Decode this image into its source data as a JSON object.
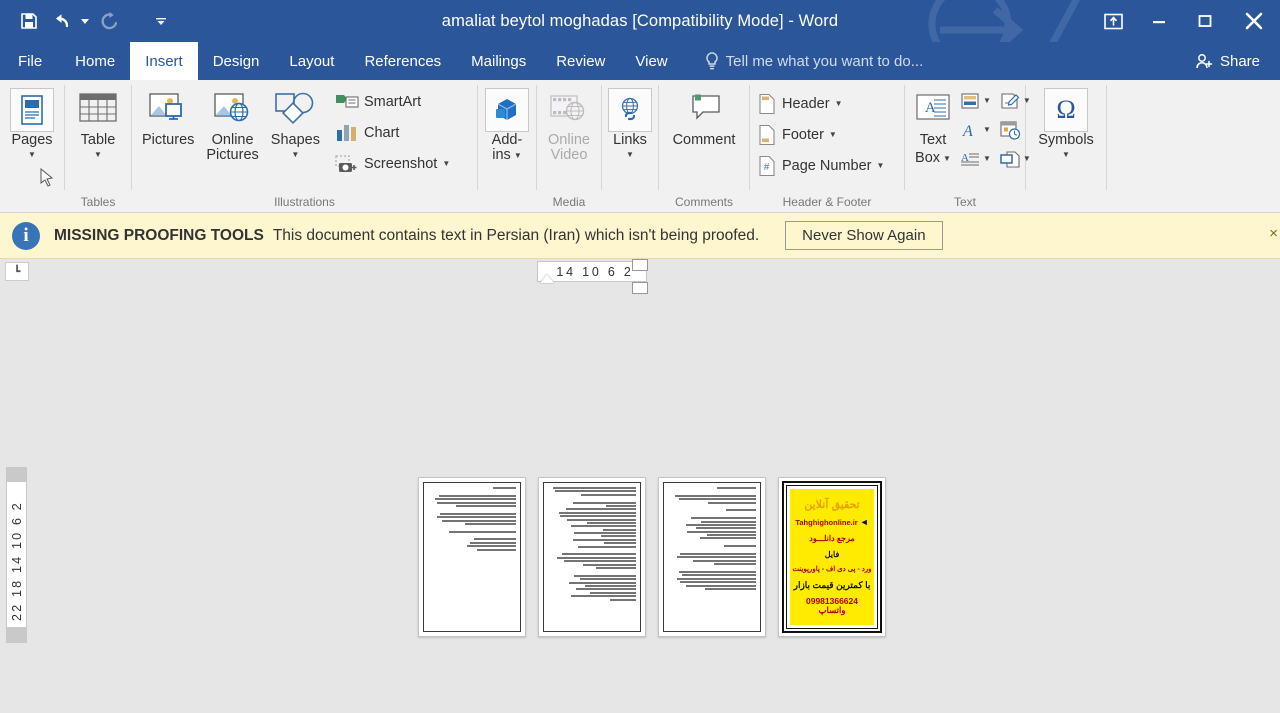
{
  "window": {
    "title": "amaliat beytol moghadas [Compatibility Mode] - Word",
    "quick_access": [
      {
        "name": "save",
        "icon": "save-icon",
        "enabled": true
      },
      {
        "name": "undo",
        "icon": "undo-icon",
        "enabled": true,
        "has_dropdown": true
      },
      {
        "name": "redo",
        "icon": "redo-icon",
        "enabled": false
      },
      {
        "name": "customize",
        "icon": "chevron-down-icon",
        "enabled": true
      }
    ],
    "controls": {
      "ribbon_display": "ribbon-display-options-icon",
      "minimize": "minimize-icon",
      "maximize": "maximize-icon",
      "close": "close-icon"
    },
    "accent_color": "#2b579a"
  },
  "tabs": [
    {
      "label": "File",
      "active": false,
      "is_file": true
    },
    {
      "label": "Home",
      "active": false
    },
    {
      "label": "Insert",
      "active": true
    },
    {
      "label": "Design",
      "active": false
    },
    {
      "label": "Layout",
      "active": false
    },
    {
      "label": "References",
      "active": false
    },
    {
      "label": "Mailings",
      "active": false
    },
    {
      "label": "Review",
      "active": false
    },
    {
      "label": "View",
      "active": false
    }
  ],
  "tellme": {
    "placeholder": "Tell me what you want to do...",
    "icon": "lightbulb-icon"
  },
  "share": {
    "label": "Share",
    "icon": "person-add-icon"
  },
  "ribbon": {
    "groups": [
      {
        "label": "",
        "name": "pages",
        "items": [
          {
            "label": "Pages",
            "icon": "page-break-icon",
            "dropdown": true,
            "style": "big-boxed"
          }
        ]
      },
      {
        "label": "Tables",
        "name": "tables",
        "items": [
          {
            "label": "Table",
            "icon": "table-icon",
            "dropdown": true,
            "style": "big"
          }
        ]
      },
      {
        "label": "Illustrations",
        "name": "illustrations",
        "items": [
          {
            "label": "Pictures",
            "icon": "pictures-icon",
            "style": "big"
          },
          {
            "label": "Online",
            "label2": "Pictures",
            "icon": "online-pictures-icon",
            "style": "big"
          },
          {
            "label": "Shapes",
            "icon": "shapes-icon",
            "dropdown": true,
            "style": "big"
          },
          {
            "label": "SmartArt",
            "icon": "smartart-icon",
            "style": "small"
          },
          {
            "label": "Chart",
            "icon": "chart-icon",
            "style": "small"
          },
          {
            "label": "Screenshot",
            "icon": "screenshot-icon",
            "dropdown": true,
            "style": "small"
          }
        ]
      },
      {
        "label": "",
        "name": "addins",
        "items": [
          {
            "label": "Add-",
            "label2": "ins",
            "icon": "addins-icon",
            "dropdown": true,
            "style": "big-boxed"
          }
        ]
      },
      {
        "label": "Media",
        "name": "media",
        "items": [
          {
            "label": "Online",
            "label2": "Video",
            "icon": "online-video-icon",
            "style": "big",
            "disabled": true
          }
        ]
      },
      {
        "label": "",
        "name": "links",
        "items": [
          {
            "label": "Links",
            "icon": "links-icon",
            "dropdown": true,
            "style": "big-boxed"
          }
        ]
      },
      {
        "label": "Comments",
        "name": "comments",
        "items": [
          {
            "label": "Comment",
            "icon": "new-comment-icon",
            "style": "big"
          }
        ]
      },
      {
        "label": "Header & Footer",
        "name": "header-footer",
        "items": [
          {
            "label": "Header",
            "icon": "header-icon",
            "dropdown": true,
            "style": "small"
          },
          {
            "label": "Footer",
            "icon": "footer-icon",
            "dropdown": true,
            "style": "small"
          },
          {
            "label": "Page Number",
            "icon": "page-number-icon",
            "dropdown": true,
            "style": "small"
          }
        ]
      },
      {
        "label": "Text",
        "name": "text",
        "items": [
          {
            "label": "Text",
            "label2": "Box",
            "icon": "text-box-icon",
            "dropdown": true,
            "style": "big"
          },
          {
            "label": "",
            "icon": "quick-parts-icon",
            "dropdown": true,
            "style": "mini"
          },
          {
            "label": "",
            "icon": "wordart-icon",
            "dropdown": true,
            "style": "mini"
          },
          {
            "label": "",
            "icon": "drop-cap-icon",
            "dropdown": true,
            "style": "mini"
          },
          {
            "label": "",
            "icon": "signature-line-icon",
            "dropdown": true,
            "style": "mini"
          },
          {
            "label": "",
            "icon": "date-time-icon",
            "style": "mini"
          },
          {
            "label": "",
            "icon": "object-icon",
            "dropdown": true,
            "style": "mini"
          }
        ]
      },
      {
        "label": "",
        "name": "symbols",
        "items": [
          {
            "label": "Symbols",
            "icon": "omega-icon",
            "dropdown": true,
            "style": "big-boxed"
          }
        ]
      }
    ]
  },
  "infobar": {
    "icon": "info-icon",
    "strong": "MISSING PROOFING TOOLS",
    "message": "This document contains text in Persian (Iran) which isn't being proofed.",
    "button": "Never Show Again",
    "close": "×",
    "background": "#fdf6ce"
  },
  "rulers": {
    "corner_icon": "tab-stop-left-icon",
    "corner_label": "┗",
    "horizontal_ticks": "14 10  6   2",
    "vertical_ticks": "22 18 14 10  6   2",
    "vertical_top_tick": "2"
  },
  "document": {
    "pages": [
      {
        "name": "page-1",
        "type": "text",
        "lang": "fa"
      },
      {
        "name": "page-2",
        "type": "text",
        "lang": "fa"
      },
      {
        "name": "page-3",
        "type": "text",
        "lang": "fa"
      },
      {
        "name": "page-4",
        "type": "advertisement",
        "background": "#ffeb00",
        "lines": [
          "تحقیق آنلاین",
          "Tahghighonline.ir",
          "مرجع دانلـــود",
          "فایل",
          "ورد - پی دی اف - پاورپوینت",
          "با کمترین قیمت بازار",
          "09981366624 واتساپ"
        ]
      }
    ]
  }
}
